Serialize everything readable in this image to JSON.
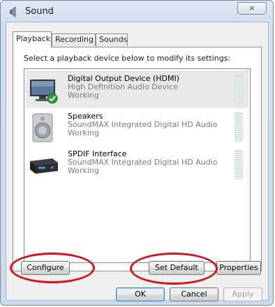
{
  "window": {
    "title": "Sound",
    "close_glyph": "⨯",
    "title_icon": "speaker-icon"
  },
  "tabs": [
    {
      "label": "Playback",
      "active": true
    },
    {
      "label": "Recording",
      "active": false
    },
    {
      "label": "Sounds",
      "active": false
    }
  ],
  "instruction": "Select a playback device below to modify its settings:",
  "devices": [
    {
      "name": "Digital Output Device (HDMI)",
      "description": "High Definition Audio Device",
      "status": "Working",
      "icon": "monitor-icon",
      "is_default": true,
      "selected": true
    },
    {
      "name": "Speakers",
      "description": "SoundMAX Integrated Digital HD Audio",
      "status": "Working",
      "icon": "speaker-icon",
      "is_default": false,
      "selected": false
    },
    {
      "name": "SPDIF Interface",
      "description": "SoundMAX Integrated Digital HD Audio",
      "status": "Working",
      "icon": "spdif-receiver-icon",
      "is_default": false,
      "selected": false
    }
  ],
  "buttons": {
    "configure": "Configure",
    "set_default": "Set Default",
    "properties": "Properties",
    "ok": "OK",
    "cancel": "Cancel",
    "apply": "Apply"
  },
  "colors": {
    "annotation_red": "#d4121e",
    "default_check_green": "#2e9b2e"
  }
}
